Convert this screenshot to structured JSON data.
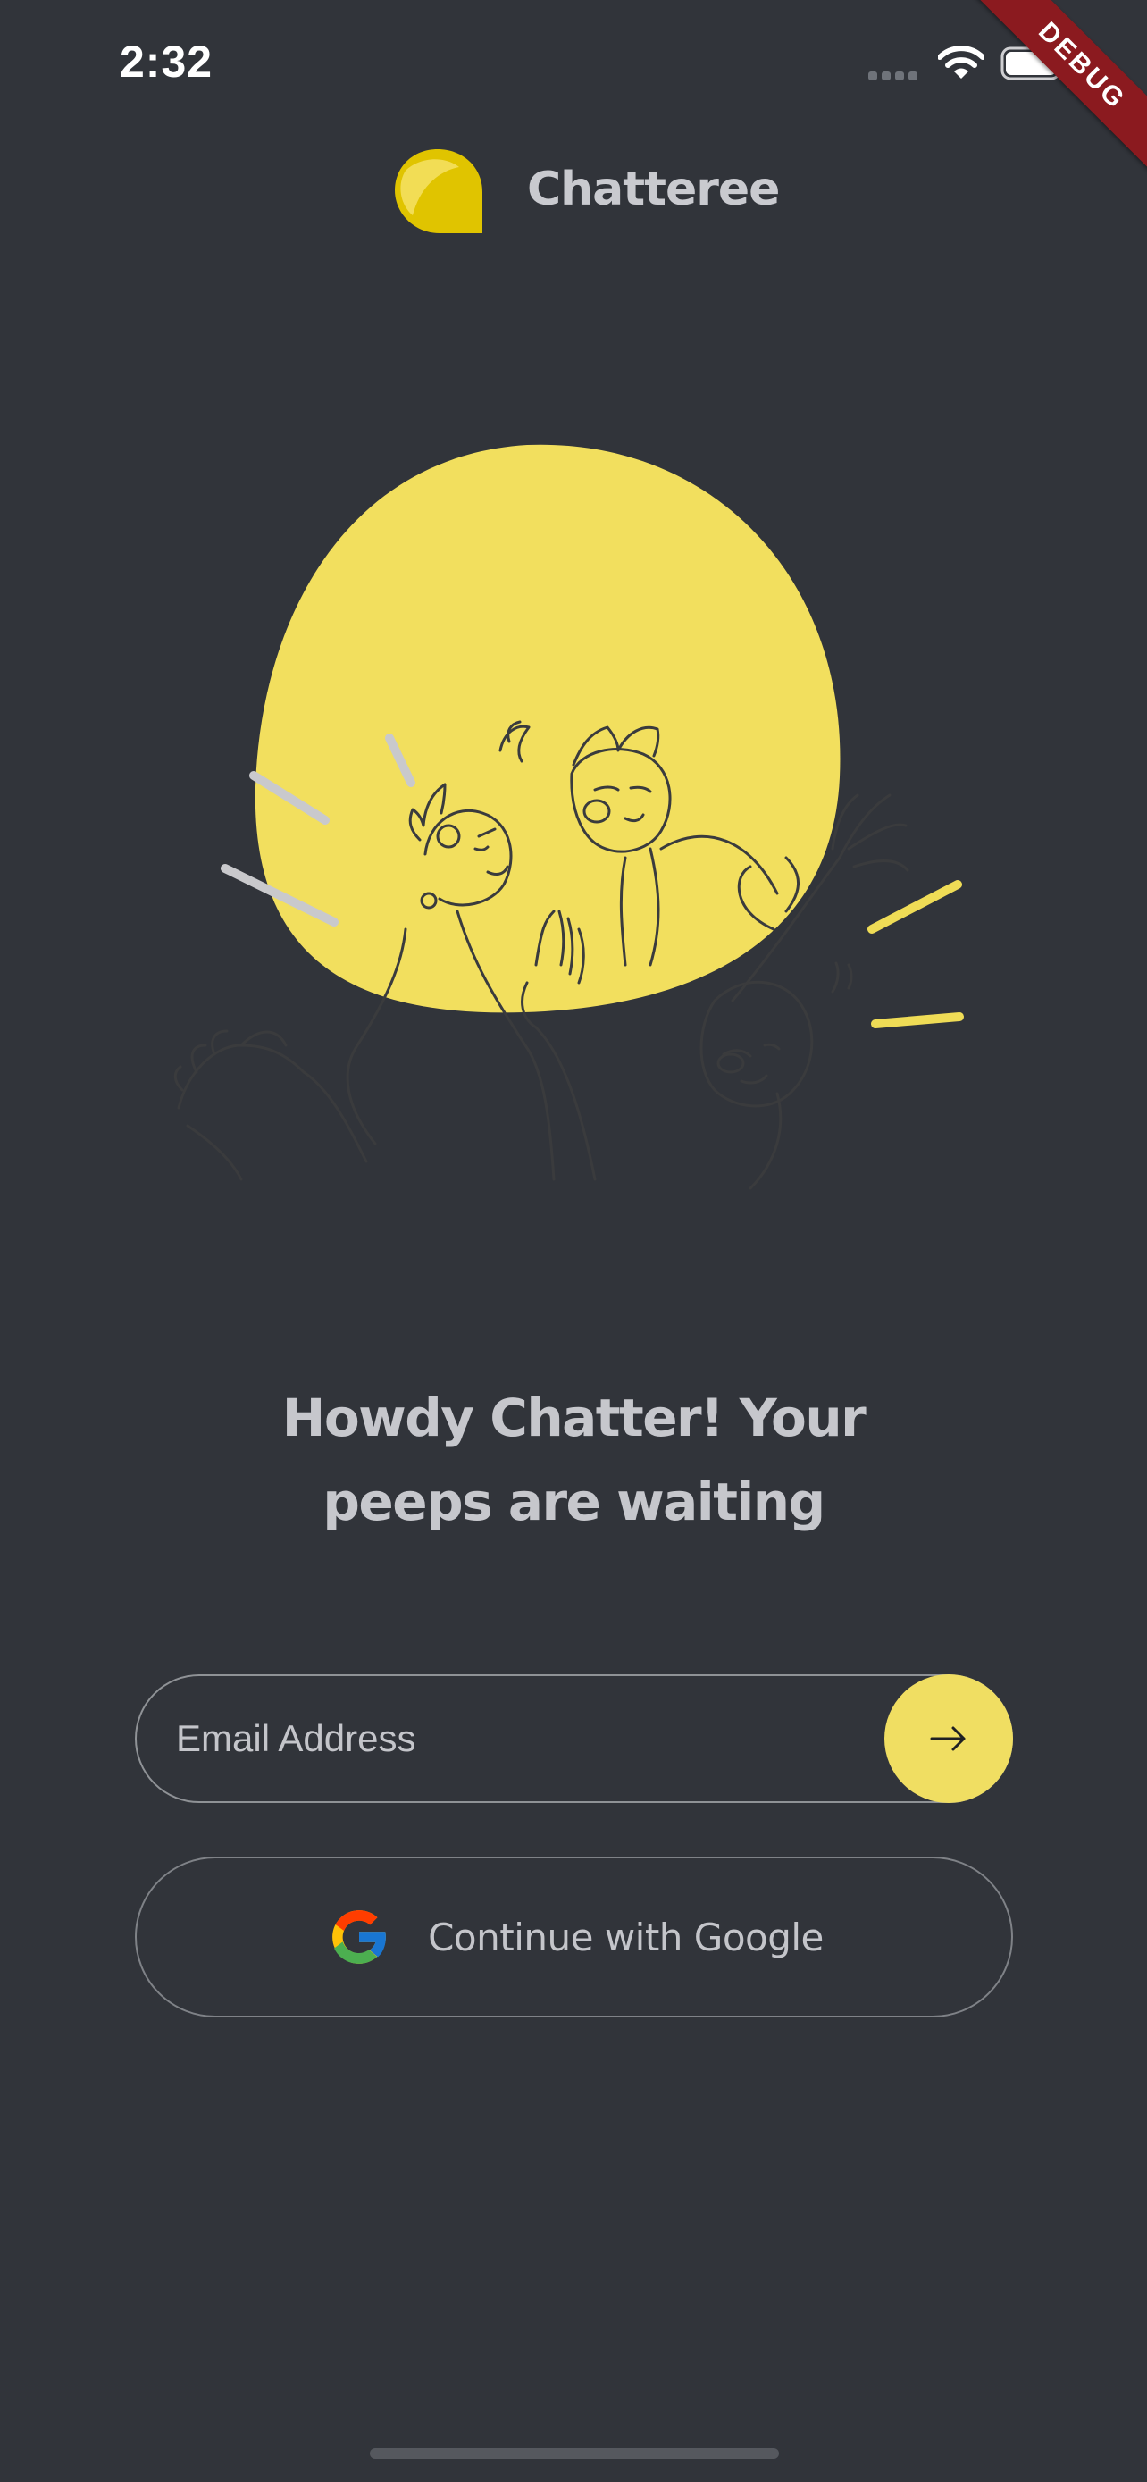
{
  "status_bar": {
    "time": "2:32"
  },
  "debug_banner": "DEBUG",
  "header": {
    "app_name": "Chatteree"
  },
  "headline": {
    "line1": "Howdy Chatter! Your",
    "line2": "peeps are waiting"
  },
  "email": {
    "placeholder": "Email Address",
    "value": ""
  },
  "google_button": {
    "label": "Continue with Google"
  },
  "colors": {
    "background": "#31343a",
    "accent": "#f0de62",
    "text": "#c6c7cc"
  }
}
